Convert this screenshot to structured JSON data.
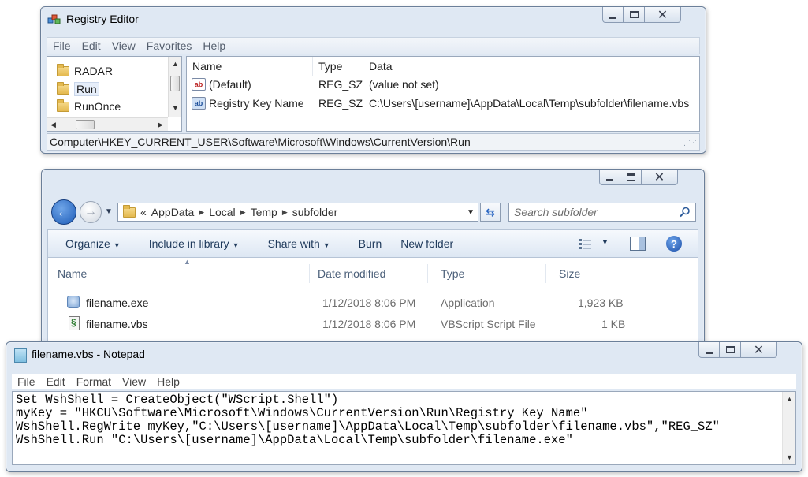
{
  "registry": {
    "title": "Registry Editor",
    "menu": [
      "File",
      "Edit",
      "View",
      "Favorites",
      "Help"
    ],
    "tree": [
      "RADAR",
      "Run",
      "RunOnce"
    ],
    "columns": [
      "Name",
      "Type",
      "Data"
    ],
    "rows": [
      {
        "name": "(Default)",
        "type": "REG_SZ",
        "data": "(value not set)"
      },
      {
        "name": "Registry Key Name",
        "type": "REG_SZ",
        "data": "C:\\Users\\[username]\\AppData\\Local\\Temp\\subfolder\\filename.vbs"
      }
    ],
    "status": "Computer\\HKEY_CURRENT_USER\\Software\\Microsoft\\Windows\\CurrentVersion\\Run"
  },
  "explorer": {
    "address": {
      "overflow": "«",
      "crumbs": [
        "AppData",
        "Local",
        "Temp",
        "subfolder"
      ]
    },
    "search_placeholder": "Search subfolder",
    "commands": [
      "Organize",
      "Include in library",
      "Share with",
      "Burn",
      "New folder"
    ],
    "columns": [
      "Name",
      "Date modified",
      "Type",
      "Size"
    ],
    "files": [
      {
        "name": "filename.exe",
        "date": "1/12/2018 8:06 PM",
        "type": "Application",
        "size": "1,923 KB"
      },
      {
        "name": "filename.vbs",
        "date": "1/12/2018 8:06 PM",
        "type": "VBScript Script File",
        "size": "1 KB"
      }
    ]
  },
  "notepad": {
    "title": "filename.vbs - Notepad",
    "menu": [
      "File",
      "Edit",
      "Format",
      "View",
      "Help"
    ],
    "lines": [
      "Set WshShell = CreateObject(\"WScript.Shell\")",
      "myKey = \"HKCU\\Software\\Microsoft\\Windows\\CurrentVersion\\Run\\Registry Key Name\"",
      "WshShell.RegWrite myKey,\"C:\\Users\\[username]\\AppData\\Local\\Temp\\subfolder\\filename.vbs\",\"REG_SZ\"",
      "WshShell.Run \"C:\\Users\\[username]\\AppData\\Local\\Temp\\subfolder\\filename.exe\""
    ]
  }
}
